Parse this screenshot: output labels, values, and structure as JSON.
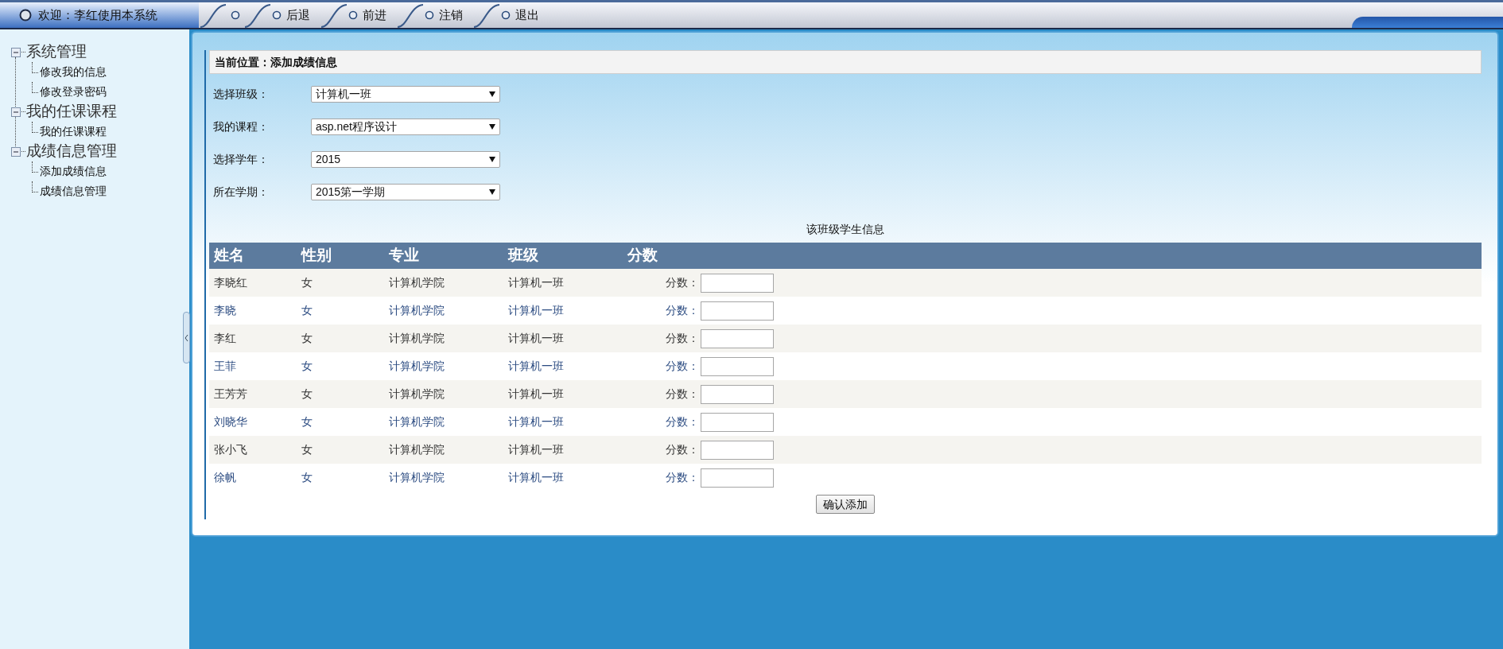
{
  "header": {
    "welcome": "欢迎：李红使用本系统",
    "nav": [
      {
        "kind": "home"
      },
      {
        "kind": "link",
        "label": "后退"
      },
      {
        "kind": "link",
        "label": "前进"
      },
      {
        "kind": "link",
        "label": "注销"
      },
      {
        "kind": "link",
        "label": "退出"
      }
    ]
  },
  "sidebar": {
    "groups": [
      {
        "label": "系统管理",
        "expanded": true,
        "children": [
          {
            "label": "修改我的信息"
          },
          {
            "label": "修改登录密码"
          }
        ]
      },
      {
        "label": "我的任课课程",
        "expanded": true,
        "children": [
          {
            "label": "我的任课课程"
          }
        ]
      },
      {
        "label": "成绩信息管理",
        "expanded": true,
        "children": [
          {
            "label": "添加成绩信息"
          },
          {
            "label": "成绩信息管理"
          }
        ]
      }
    ]
  },
  "breadcrumb": "当前位置：添加成绩信息",
  "form": [
    {
      "label": "选择班级：",
      "value": "计算机一班"
    },
    {
      "label": "我的课程：",
      "value": "asp.net程序设计"
    },
    {
      "label": "选择学年：",
      "value": "2015"
    },
    {
      "label": "所在学期：",
      "value": "2015第一学期"
    }
  ],
  "table": {
    "caption": "该班级学生信息",
    "columns": [
      "姓名",
      "性别",
      "专业",
      "班级",
      "分数"
    ],
    "rows": [
      {
        "cells": [
          "李晓红",
          "女",
          "计算机学院",
          "计算机一班"
        ],
        "score_label": "分数："
      },
      {
        "cells": [
          "李晓",
          "女",
          "计算机学院",
          "计算机一班"
        ],
        "score_label": "分数："
      },
      {
        "cells": [
          "李红",
          "女",
          "计算机学院",
          "计算机一班"
        ],
        "score_label": "分数："
      },
      {
        "cells": [
          "王菲",
          "女",
          "计算机学院",
          "计算机一班"
        ],
        "score_label": "分数："
      },
      {
        "cells": [
          "王芳芳",
          "女",
          "计算机学院",
          "计算机一班"
        ],
        "score_label": "分数："
      },
      {
        "cells": [
          "刘晓华",
          "女",
          "计算机学院",
          "计算机一班"
        ],
        "score_label": "分数："
      },
      {
        "cells": [
          "张小飞",
          "女",
          "计算机学院",
          "计算机一班"
        ],
        "score_label": "分数："
      },
      {
        "cells": [
          "徐帆",
          "女",
          "计算机学院",
          "计算机一班"
        ],
        "score_label": "分数："
      }
    ]
  },
  "submit_button": "确认添加"
}
